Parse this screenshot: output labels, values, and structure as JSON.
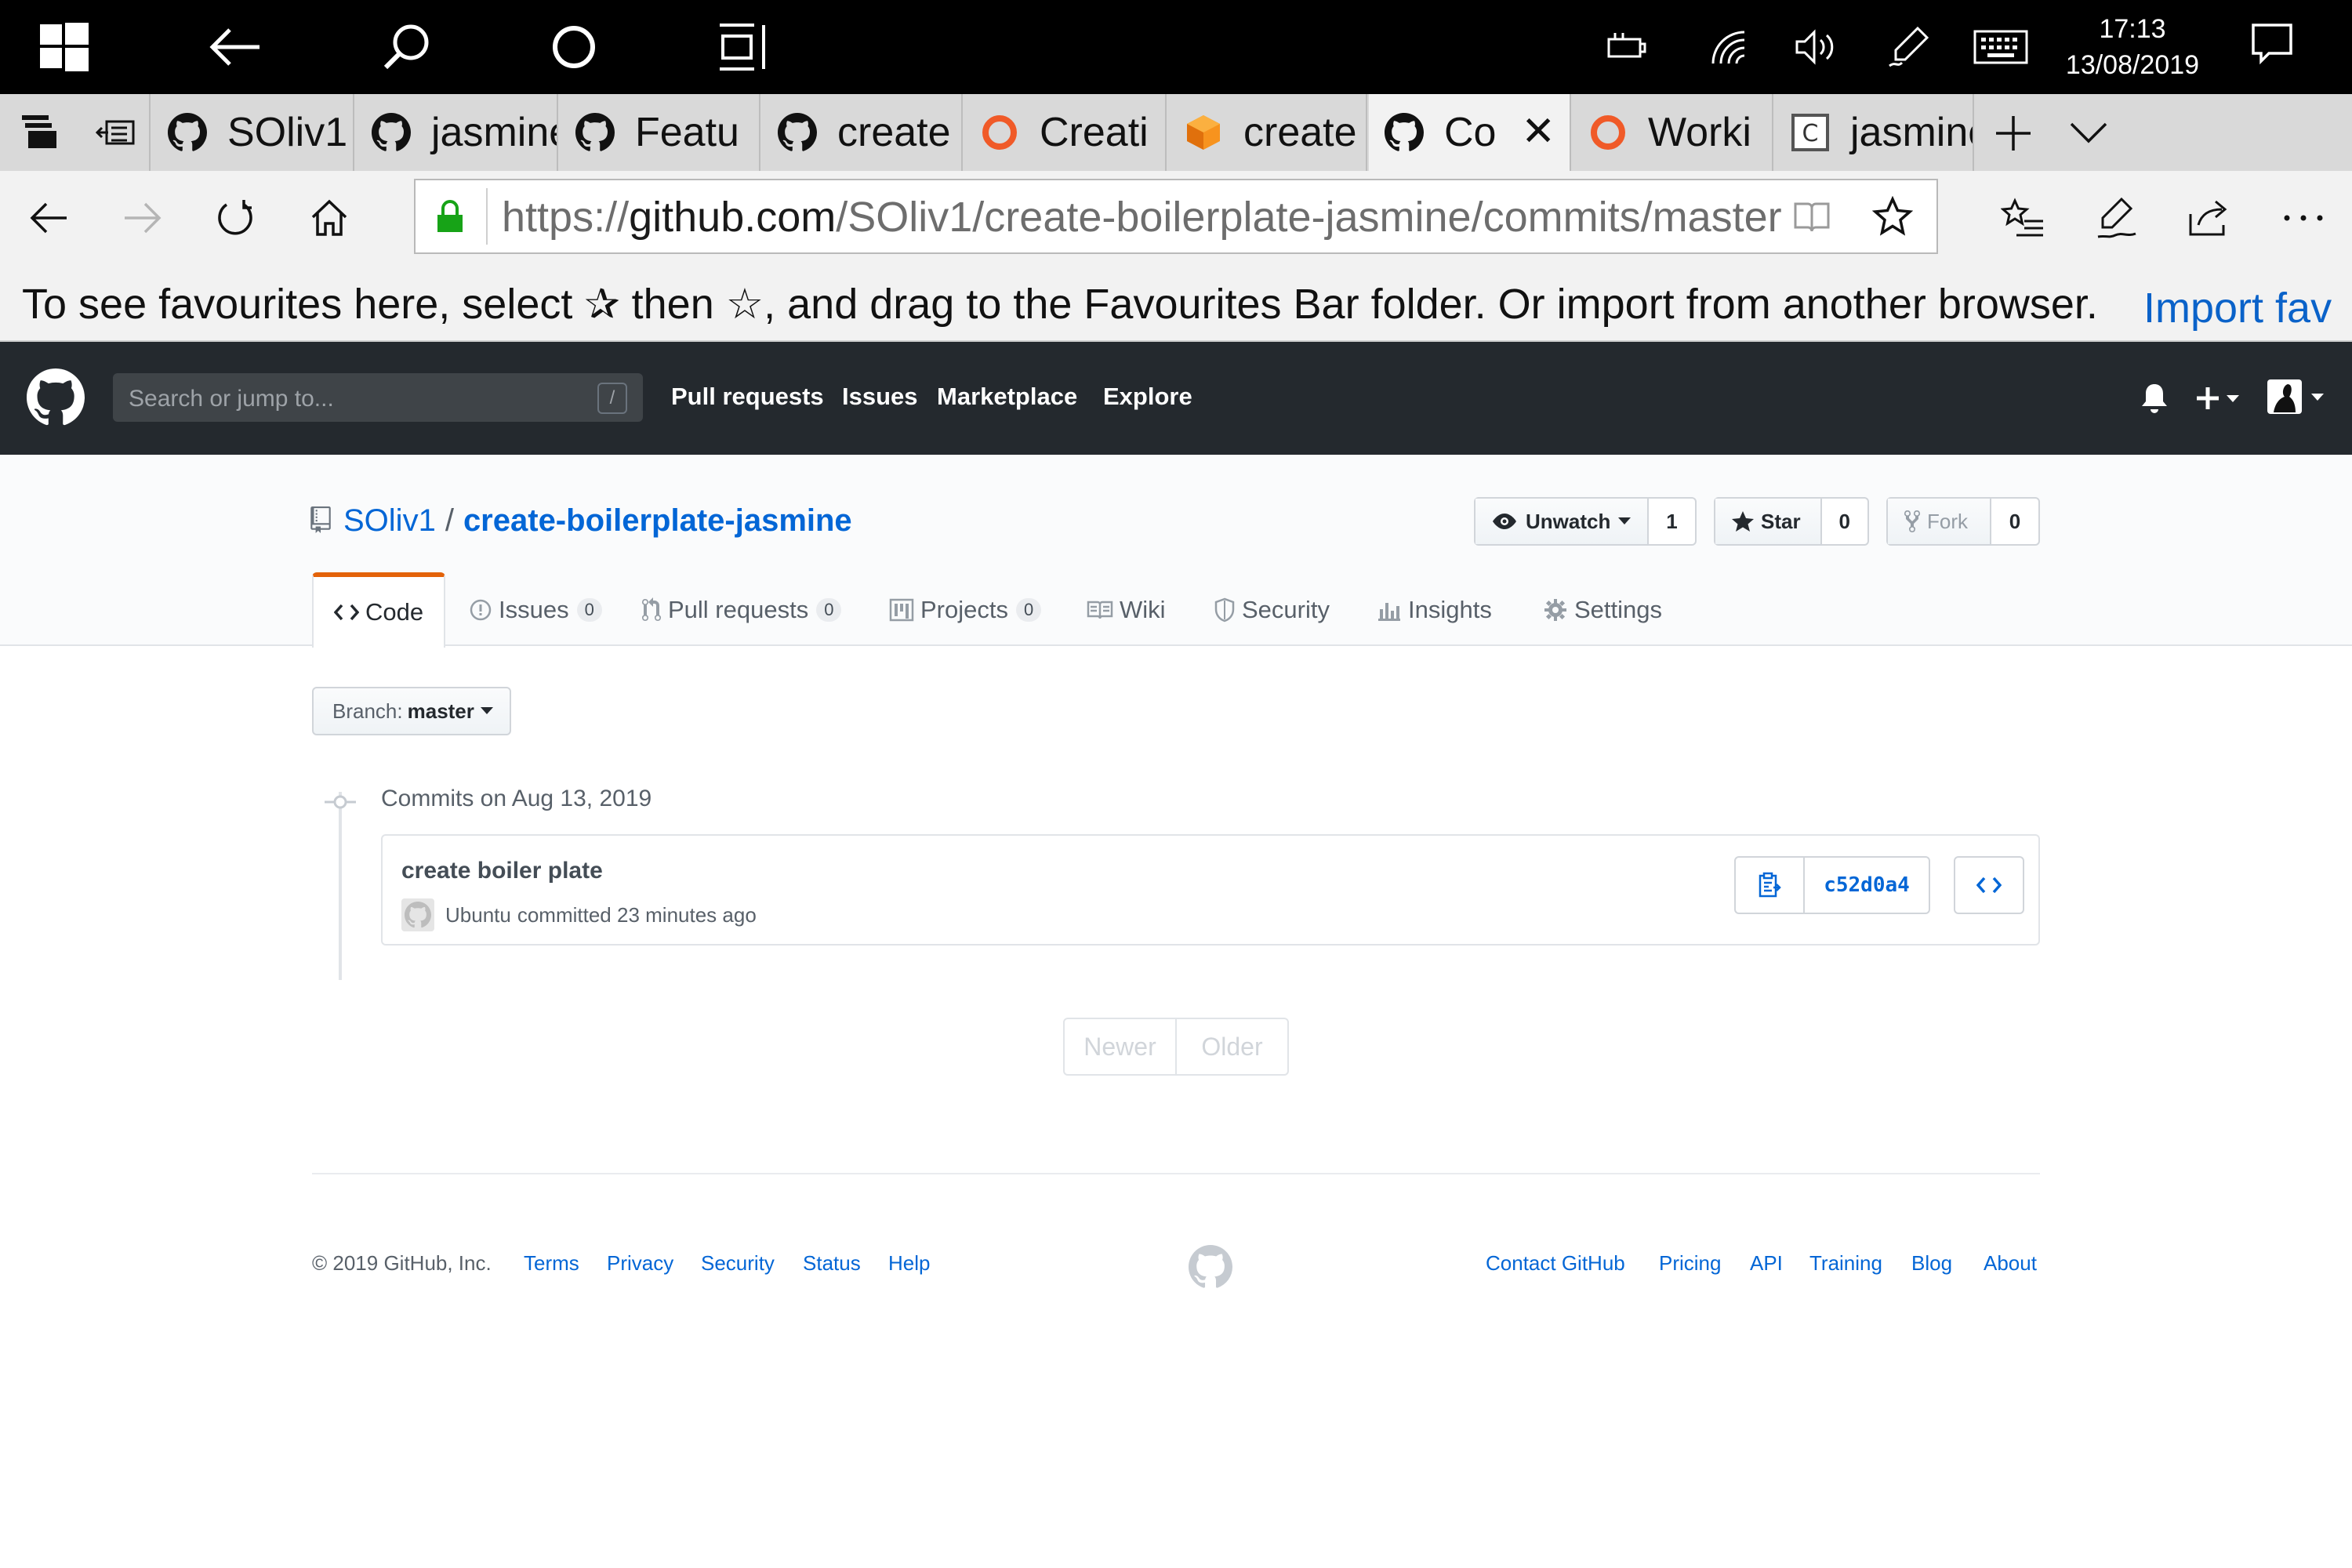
{
  "taskbar": {
    "icons": [
      "windows-logo-icon",
      "back-arrow-icon",
      "search-icon",
      "cortana-icon",
      "task-view-icon"
    ],
    "tray_icons": [
      "battery-icon",
      "wifi-icon",
      "volume-icon",
      "pen-icon",
      "keyboard-icon"
    ],
    "time": "17:13",
    "date": "13/08/2019"
  },
  "tabs": [
    {
      "label": "SOliv1",
      "icon": "github-icon",
      "active": false
    },
    {
      "label": "jasmine",
      "icon": "github-icon",
      "active": false
    },
    {
      "label": "Featu",
      "icon": "github-icon",
      "active": false
    },
    {
      "label": "create",
      "icon": "github-icon",
      "active": false
    },
    {
      "label": "Creati",
      "icon": "orange-ring-icon",
      "active": false
    },
    {
      "label": "create",
      "icon": "orange-box-icon",
      "active": false
    },
    {
      "label": "Co",
      "icon": "github-icon",
      "active": true
    },
    {
      "label": "Worki",
      "icon": "orange-ring-icon",
      "active": false
    },
    {
      "label": "jasmine",
      "icon": "codepen-c-icon",
      "active": false
    }
  ],
  "browser": {
    "url_prefix": "https://",
    "url_host": "github.com",
    "url_path": "/SOliv1/create-boilerplate-jasmine/commits/master",
    "fav_hint": "To see favourites here, select  ✰  then ☆, and drag to the Favourites Bar folder. Or import from another browser.",
    "fav_link": "Import fav"
  },
  "github": {
    "search_placeholder": "Search or jump to...",
    "slash_key": "/",
    "nav": [
      "Pull requests",
      "Issues",
      "Marketplace",
      "Explore"
    ],
    "repo_owner": "SOliv1",
    "repo_sep": "/",
    "repo_name": "create-boilerplate-jasmine",
    "watch_label": "Unwatch",
    "watch_count": "1",
    "star_label": "Star",
    "star_count": "0",
    "fork_label": "Fork",
    "fork_count": "0",
    "tabs": {
      "code": "Code",
      "issues": "Issues",
      "issues_count": "0",
      "pulls": "Pull requests",
      "pulls_count": "0",
      "projects": "Projects",
      "projects_count": "0",
      "wiki": "Wiki",
      "security": "Security",
      "insights": "Insights",
      "settings": "Settings"
    },
    "branch_label": "Branch:",
    "branch_value": "master",
    "commits_date": "Commits on Aug 13, 2019",
    "commit": {
      "message": "create boiler plate",
      "author": "Ubuntu",
      "meta": "committed 23 minutes ago",
      "sha": "c52d0a4"
    },
    "pager_newer": "Newer",
    "pager_older": "Older",
    "footer": {
      "copyright": "© 2019 GitHub, Inc.",
      "left_links": [
        "Terms",
        "Privacy",
        "Security",
        "Status",
        "Help"
      ],
      "right_links": [
        "Contact GitHub",
        "Pricing",
        "API",
        "Training",
        "Blog",
        "About"
      ]
    }
  }
}
